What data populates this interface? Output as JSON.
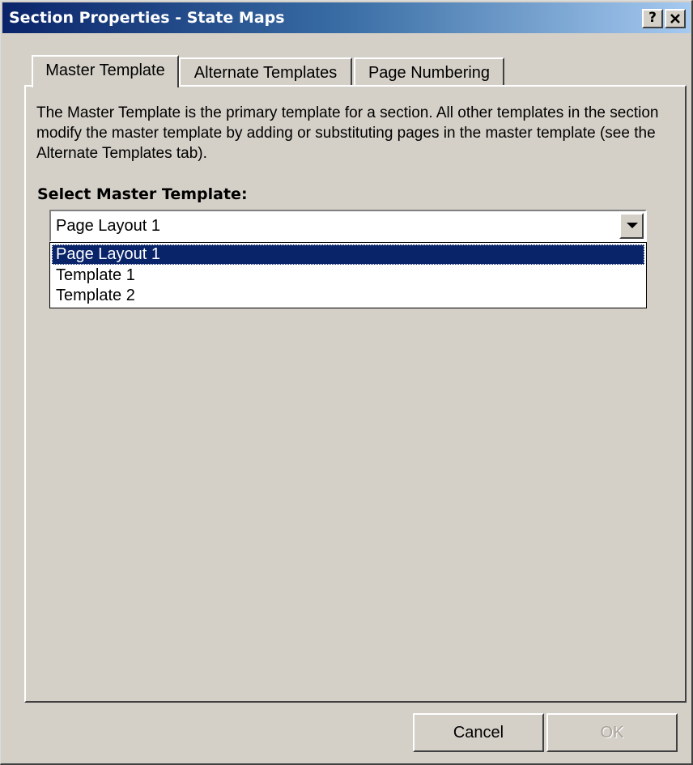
{
  "window": {
    "title": "Section Properties - State Maps",
    "help_label": "?",
    "close_label": "✕"
  },
  "tabs": [
    {
      "label": "Master Template",
      "active": true
    },
    {
      "label": "Alternate Templates",
      "active": false
    },
    {
      "label": "Page Numbering",
      "active": false
    }
  ],
  "content": {
    "description": "The Master Template is the primary template for a section.  All other templates in the section modify the master template by adding or substituting pages in the master template (see the Alternate Templates tab).",
    "select_label": "Select Master Template:"
  },
  "combo": {
    "value": "Page Layout 1",
    "options": [
      "Page Layout 1",
      "Template 1",
      "Template 2"
    ],
    "selected_index": 0
  },
  "buttons": {
    "cancel": "Cancel",
    "ok": "OK",
    "ok_enabled": false
  },
  "colors": {
    "dialog_face": "#d4d0c8",
    "titlebar_start": "#0a246a",
    "titlebar_end": "#a6caf0",
    "selection": "#0a246a"
  }
}
